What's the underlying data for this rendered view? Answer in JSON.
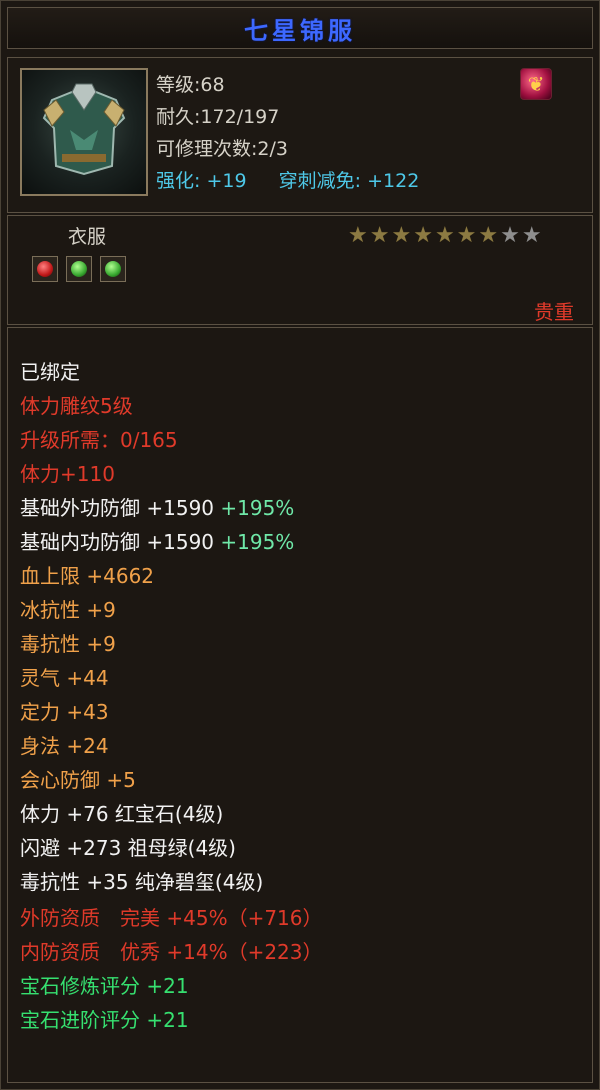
{
  "title": "七星锦服",
  "info": {
    "level": "等级:68",
    "durability": "耐久:172/197",
    "repair": "可修理次数:2/3",
    "enhance_label": "强化:",
    "enhance_value": "+19",
    "pierce_label": "穿刺减免:",
    "pierce_value": "+122"
  },
  "item_type": "衣服",
  "stars": {
    "filled": 7,
    "total": 9
  },
  "rarity": "贵重",
  "gems": [
    "red-gem",
    "green-gem",
    "green-gem"
  ],
  "colors": {
    "title": "#3d68ff",
    "red": "#e03a2a",
    "orange": "#f0a14a",
    "cyan": "#4ec8e8",
    "green": "#36e070"
  },
  "stats": {
    "bound": "已绑定",
    "engrave": "体力雕纹5级",
    "upgrade": "升级所需：0/165",
    "stamina_bonus": "体力+110",
    "outer_def_base": "基础外功防御 +1590",
    "outer_def_pct": "+195%",
    "inner_def_base": "基础内功防御 +1590",
    "inner_def_pct": "+195%",
    "hp_max": "血上限 +4662",
    "ice_res": "冰抗性 +9",
    "poison_res": "毒抗性 +9",
    "spirit": "灵气 +44",
    "focus": "定力 +43",
    "agility": "身法 +24",
    "crit_def": "会心防御 +5",
    "gem1": "体力 +76 红宝石(4级)",
    "gem2": "闪避 +273 祖母绿(4级)",
    "gem3": "毒抗性 +35 纯净碧玺(4级)",
    "outer_quality": "外防资质　完美 +45%（+716）",
    "inner_quality": "内防资质　优秀 +14%（+223）",
    "gem_train": "宝石修炼评分 +21",
    "gem_advance": "宝石进阶评分 +21"
  }
}
